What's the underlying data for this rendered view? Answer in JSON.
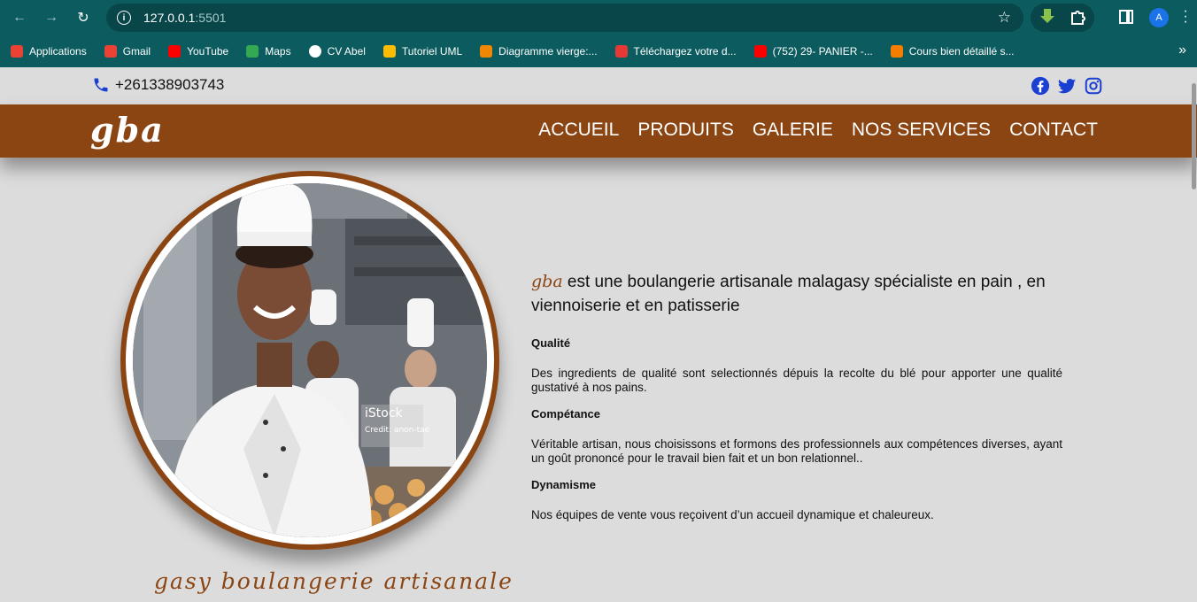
{
  "browser": {
    "url_host": "127.0.0.1",
    "url_port": ":5501",
    "bookmarks": [
      {
        "label": "Applications",
        "icon": "apps-grid-icon",
        "color": "#ea4335"
      },
      {
        "label": "Gmail",
        "icon": "gmail-icon",
        "color": "#ea4335"
      },
      {
        "label": "YouTube",
        "icon": "youtube-icon",
        "color": "#ff0000"
      },
      {
        "label": "Maps",
        "icon": "maps-pin-icon",
        "color": "#34a853"
      },
      {
        "label": "CV Abel",
        "icon": "globe-icon",
        "color": "#ffffff"
      },
      {
        "label": "Tutoriel UML",
        "icon": "dots-icon",
        "color": "#fbbc05"
      },
      {
        "label": "Diagramme vierge:...",
        "icon": "diagram-icon",
        "color": "#f08705"
      },
      {
        "label": "Téléchargez votre d...",
        "icon": "refresh-red-icon",
        "color": "#e53935"
      },
      {
        "label": "(752) 29- PANIER -...",
        "icon": "youtube-icon",
        "color": "#ff0000"
      },
      {
        "label": "Cours bien détaillé s...",
        "icon": "blogger-icon",
        "color": "#f57d00"
      }
    ]
  },
  "topbar": {
    "phone": "+261338903743",
    "socials": [
      "facebook-icon",
      "twitter-icon",
      "instagram-icon"
    ]
  },
  "header": {
    "logo": "gba",
    "menu": [
      "ACCUEIL",
      "PRODUITS",
      "GALERIE",
      "NOS SERVICES",
      "CONTACT"
    ]
  },
  "hero": {
    "photo_watermark": "iStock",
    "photo_credit": "Credit: anon-tae",
    "tagline": "gasy boulangerie artisanale"
  },
  "content": {
    "brand": "gba",
    "intro": " est une boulangerie artisanale malagasy spécialiste en pain , en viennoiserie et en patisserie",
    "features": [
      {
        "title": "Qualité",
        "text": "Des ingredients de qualité sont selectionnés dépuis la recolte du blé pour apporter une qualité gustativé à nos pains."
      },
      {
        "title": "Compétance",
        "text": "Véritable artisan, nous choisissons et formons des professionnels aux compétences diverses, ayant un goût prononcé pour le travail bien fait et un bon relationnel.."
      },
      {
        "title": "Dynamisme",
        "text": "Nos équipes de vente vous reçoivent d’un accueil dynamique et chaleureux."
      }
    ]
  },
  "colors": {
    "brand_brown": "#8b4513",
    "chrome_teal": "#0b5b5f",
    "link_blue": "#1877f2"
  }
}
